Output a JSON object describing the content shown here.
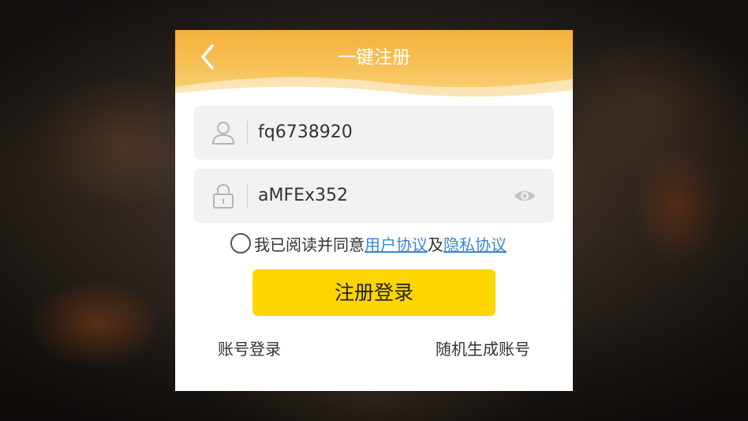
{
  "dialog": {
    "title": "一键注册",
    "back_icon": "chevron-left-icon",
    "header_color": "#f4b13c"
  },
  "username_field": {
    "icon": "user-icon",
    "value": "fq6738920"
  },
  "password_field": {
    "icon": "lock-icon",
    "value": "aMFEx352",
    "toggle_icon": "eye-icon"
  },
  "agreement": {
    "prefix": "我已阅读并同意",
    "user_agreement": "用户协议",
    "conjunction": "及",
    "privacy_agreement": "隐私协议",
    "checked": false,
    "link_color": "#3a86d6"
  },
  "submit_label": "注册登录",
  "submit_color": "#ffd500",
  "bottom_links": {
    "account_login": "账号登录",
    "random_account": "随机生成账号"
  }
}
